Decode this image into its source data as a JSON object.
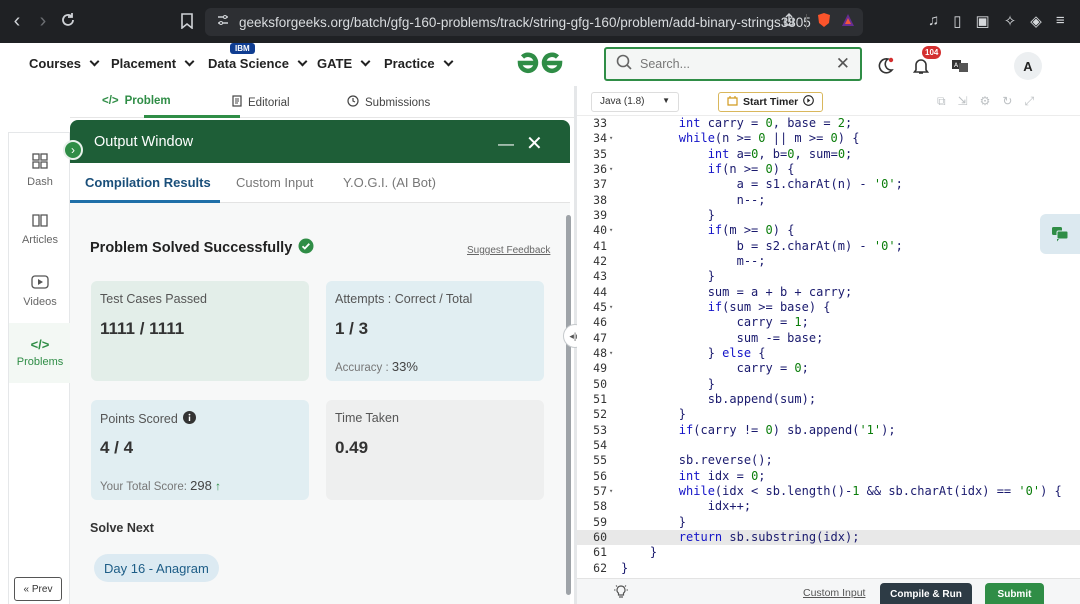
{
  "browser": {
    "url": "geeksforgeeks.org/batch/gfg-160-problems/track/string-gfg-160/problem/add-binary-strings3805"
  },
  "header": {
    "menus": [
      {
        "label": "Courses"
      },
      {
        "label": "Placement"
      },
      {
        "label": "Data Science"
      },
      {
        "label": "GATE"
      },
      {
        "label": "Practice"
      }
    ],
    "ibm_badge": "IBM",
    "logo": "gfg-logo",
    "search_placeholder": "Search...",
    "notification_count": "104",
    "avatar_letter": "A",
    "accent_color": "#2f8d46"
  },
  "sidebar": {
    "items": [
      {
        "label": "Dash",
        "icon": "dashboard-icon"
      },
      {
        "label": "Articles",
        "icon": "book-icon"
      },
      {
        "label": "Videos",
        "icon": "video-icon"
      },
      {
        "label": "Problems",
        "icon": "code-icon"
      }
    ],
    "prev_label": "« Prev"
  },
  "problem_tabs": [
    {
      "label": "Problem"
    },
    {
      "label": "Editorial"
    },
    {
      "label": "Submissions"
    }
  ],
  "output": {
    "title": "Output Window",
    "tabs": [
      {
        "label": "Compilation Results"
      },
      {
        "label": "Custom Input"
      },
      {
        "label": "Y.O.G.I. (AI Bot)"
      }
    ],
    "status": "Problem Solved Successfully",
    "feedback": "Suggest Feedback",
    "cards": {
      "test_cases": {
        "label": "Test Cases Passed",
        "value": "1111 / 1111"
      },
      "attempts": {
        "label": "Attempts : Correct / Total",
        "value": "1 / 3",
        "sub_label": "Accuracy :",
        "sub_value": "33%"
      },
      "points": {
        "label": "Points Scored",
        "value": "4 / 4",
        "sub_label": "Your Total Score:",
        "sub_value": "298"
      },
      "time": {
        "label": "Time Taken",
        "value": "0.49"
      }
    },
    "solve_next_label": "Solve Next",
    "next_problem": "Day 16 - Anagram"
  },
  "editor": {
    "language": "Java (1.8)",
    "timer_label": "Start Timer",
    "lines": [
      {
        "n": "33",
        "fold": "",
        "t": "        int carry = 0, base = 2;"
      },
      {
        "n": "34",
        "fold": "▾",
        "t": "        while(n >= 0 || m >= 0) {"
      },
      {
        "n": "35",
        "fold": "",
        "t": "            int a=0, b=0, sum=0;"
      },
      {
        "n": "36",
        "fold": "▾",
        "t": "            if(n >= 0) {"
      },
      {
        "n": "37",
        "fold": "",
        "t": "                a = s1.charAt(n) - '0';"
      },
      {
        "n": "38",
        "fold": "",
        "t": "                n--;"
      },
      {
        "n": "39",
        "fold": "",
        "t": "            }"
      },
      {
        "n": "40",
        "fold": "▾",
        "t": "            if(m >= 0) {"
      },
      {
        "n": "41",
        "fold": "",
        "t": "                b = s2.charAt(m) - '0';"
      },
      {
        "n": "42",
        "fold": "",
        "t": "                m--;"
      },
      {
        "n": "43",
        "fold": "",
        "t": "            }"
      },
      {
        "n": "44",
        "fold": "",
        "t": "            sum = a + b + carry;"
      },
      {
        "n": "45",
        "fold": "▾",
        "t": "            if(sum >= base) {"
      },
      {
        "n": "46",
        "fold": "",
        "t": "                carry = 1;"
      },
      {
        "n": "47",
        "fold": "",
        "t": "                sum -= base;"
      },
      {
        "n": "48",
        "fold": "▾",
        "t": "            } else {"
      },
      {
        "n": "49",
        "fold": "",
        "t": "                carry = 0;"
      },
      {
        "n": "50",
        "fold": "",
        "t": "            }"
      },
      {
        "n": "51",
        "fold": "",
        "t": "            sb.append(sum);"
      },
      {
        "n": "52",
        "fold": "",
        "t": "        }"
      },
      {
        "n": "53",
        "fold": "",
        "t": "        if(carry != 0) sb.append('1');"
      },
      {
        "n": "54",
        "fold": "",
        "t": ""
      },
      {
        "n": "55",
        "fold": "",
        "t": "        sb.reverse();"
      },
      {
        "n": "56",
        "fold": "",
        "t": "        int idx = 0;"
      },
      {
        "n": "57",
        "fold": "▾",
        "t": "        while(idx < sb.length()-1 && sb.charAt(idx) == '0') {"
      },
      {
        "n": "58",
        "fold": "",
        "t": "            idx++;"
      },
      {
        "n": "59",
        "fold": "",
        "t": "        }"
      },
      {
        "n": "60",
        "fold": "",
        "t": "        return sb.substring(idx);"
      },
      {
        "n": "61",
        "fold": "",
        "t": "    }"
      },
      {
        "n": "62",
        "fold": "",
        "t": "}"
      }
    ],
    "highlighted_line": "60",
    "custom_input": "Custom Input",
    "compile_label": "Compile & Run",
    "submit_label": "Submit"
  }
}
